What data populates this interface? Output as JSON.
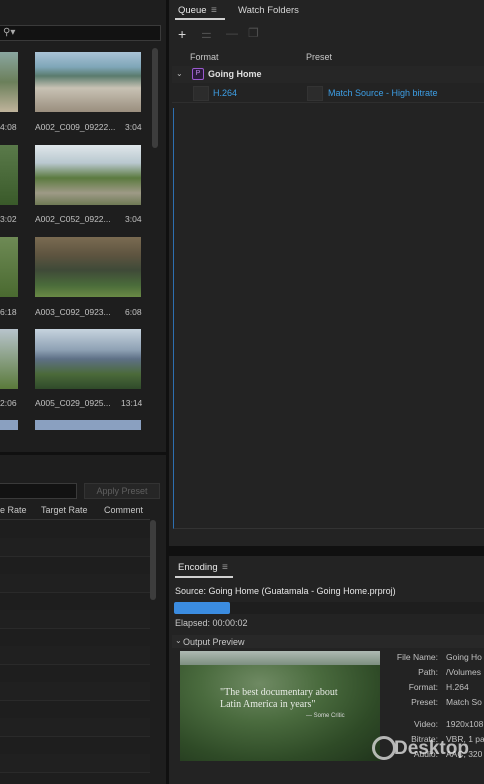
{
  "media_browser": {
    "clips": [
      {
        "name": "A002_C009_09222...",
        "duration": "3:04",
        "left_duration": "4:08"
      },
      {
        "name": "A002_C052_0922...",
        "duration": "3:04",
        "left_duration": "3:02"
      },
      {
        "name": "A003_C092_0923...",
        "duration": "6:08",
        "left_duration": "6:18"
      },
      {
        "name": "A005_C029_0925...",
        "duration": "13:14",
        "left_duration": "2:06"
      }
    ]
  },
  "preset_browser": {
    "apply_preset_label": "Apply Preset",
    "columns": [
      "e Rate",
      "Target Rate",
      "Comment"
    ]
  },
  "queue": {
    "tabs": [
      "Queue",
      "Watch Folders"
    ],
    "columns": {
      "format": "Format",
      "preset": "Preset"
    },
    "item": {
      "name": "Going Home",
      "format": "H.264",
      "preset": "Match Source - High bitrate"
    }
  },
  "encoding": {
    "title": "Encoding",
    "source": "Source: Going Home (Guatamala - Going Home.prproj)",
    "elapsed": "Elapsed: 00:00:02",
    "progress": 0.2,
    "output_preview_label": "Output Preview",
    "preview_caption": "\"The best documentary about Latin America in years\"",
    "preview_credit": "— Some Critic",
    "meta": [
      {
        "key": "File Name:",
        "value": "Going Ho"
      },
      {
        "key": "Path:",
        "value": "/Volumes"
      },
      {
        "key": "Format:",
        "value": "H.264"
      },
      {
        "key": "Preset:",
        "value": "Match So"
      },
      {
        "key": "Video:",
        "value": "1920x108"
      },
      {
        "key": "Bitrate:",
        "value": "VBR, 1 pa"
      },
      {
        "key": "Audio:",
        "value": "AAC, 320"
      }
    ]
  },
  "watermark": {
    "text": "Desktop"
  }
}
